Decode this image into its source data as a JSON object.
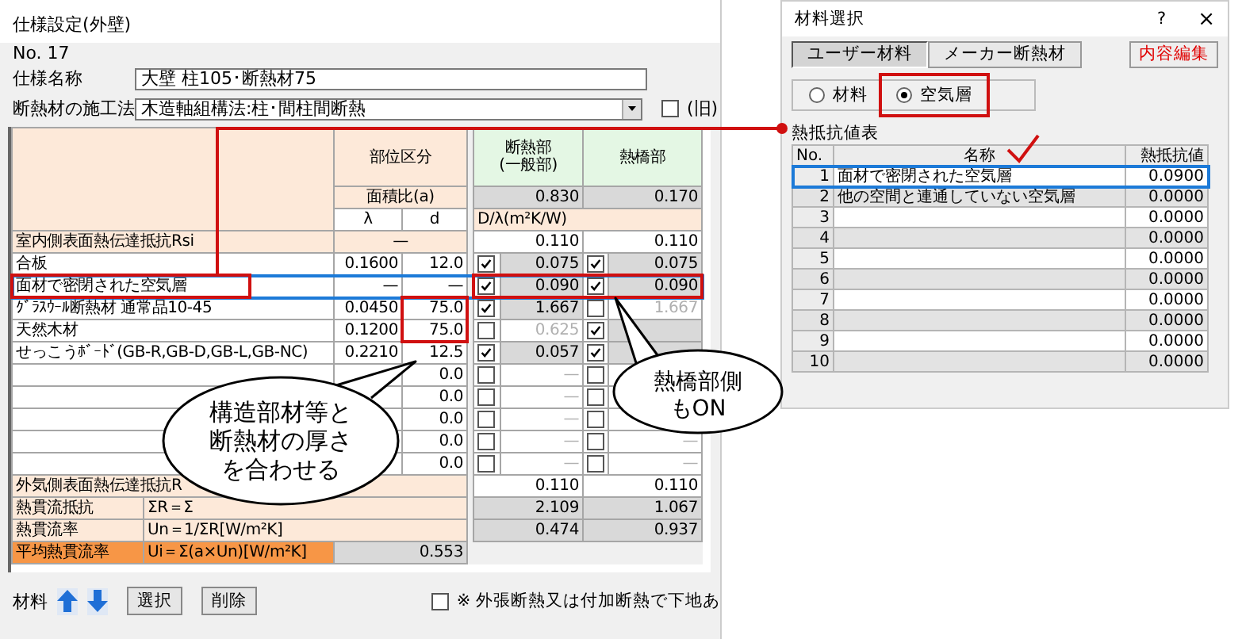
{
  "main_window": {
    "title": "仕様設定(外壁)",
    "number": "No. 17",
    "spec_name": {
      "label": "仕様名称",
      "value": "大壁  柱105･断熱材75"
    },
    "method": {
      "label": "断熱材の施工法",
      "value": "木造軸組構法:柱･間柱間断熱"
    },
    "old_option": {
      "label": "(旧)",
      "checked": false
    },
    "header": {
      "category": "部位区分",
      "insulated": "断熱部\n(一般部)",
      "bridge": "熱橋部",
      "area_ratio_label": "面積比(a)",
      "area_ratio_insulated": "0.830",
      "area_ratio_bridge": "0.170",
      "lambda": "λ",
      "d": "d",
      "resistance_unit": "D/λ(m²K/W)"
    },
    "surface_inner": {
      "name": "室内側表面熱伝達抵抗Rsi",
      "lambda_d": "—",
      "insulated": "0.110",
      "bridge": "0.110"
    },
    "layers": [
      {
        "name": "合板",
        "lambda": "0.1600",
        "d": "12.0",
        "insulated_on": true,
        "insulated": "0.075",
        "bridge_on": true,
        "bridge": "0.075",
        "selected": false
      },
      {
        "name": "面材で密閉された空気層",
        "lambda": "—",
        "d": "—",
        "insulated_on": true,
        "insulated": "0.090",
        "bridge_on": true,
        "bridge": "0.090",
        "selected": true
      },
      {
        "name": "ｸﾞﾗｽｳｰﾙ断熱材 通常品10-45",
        "lambda": "0.0450",
        "d": "75.0",
        "insulated_on": true,
        "insulated": "1.667",
        "bridge_on": false,
        "bridge": "1.667",
        "selected": false
      },
      {
        "name": "天然木材",
        "lambda": "0.1200",
        "d": "75.0",
        "insulated_on": false,
        "insulated": "0.625",
        "bridge_on": true,
        "selected": false
      },
      {
        "name": "せっこうﾎﾞｰﾄﾞ(GB-R,GB-D,GB-L,GB-NC)",
        "lambda": "0.2210",
        "d": "12.5",
        "insulated_on": true,
        "insulated": "0.057",
        "bridge_on": true,
        "selected": false
      },
      {
        "d": "0.0",
        "insulated_on": false,
        "insulated": "—",
        "bridge_on": false,
        "selected": false
      },
      {
        "d": "0.0",
        "insulated_on": false,
        "insulated": "—",
        "bridge_on": false,
        "selected": false
      },
      {
        "d": "0.0",
        "insulated_on": false,
        "insulated": "—",
        "bridge_on": false,
        "selected": false
      },
      {
        "d": "0.0",
        "insulated_on": false,
        "insulated": "—",
        "bridge_on": false,
        "bridge": "—",
        "selected": false
      },
      {
        "d": "0.0",
        "insulated_on": false,
        "insulated": "—",
        "bridge_on": false,
        "bridge": "—",
        "selected": false
      }
    ],
    "totals": [
      {
        "kind": "surface",
        "name": "外気側表面熱伝達抵抗R",
        "insulated": "0.110",
        "bridge": "0.110"
      },
      {
        "kind": "sum",
        "name": "熱貫流抵抗",
        "formula": "ΣR＝Σ",
        "insulated": "2.109",
        "bridge": "1.067"
      },
      {
        "kind": "sum",
        "name": "熱貫流率",
        "formula": "Un＝1/ΣR[W/m²K]",
        "insulated": "0.474",
        "bridge": "0.937"
      }
    ],
    "average": {
      "name": "平均熱貫流率",
      "formula": "Ui＝Σ(a×Un)[W/m²K]",
      "value": "0.553"
    },
    "toolbar": {
      "label": "材料",
      "buttons": [
        "選択",
        "削除"
      ],
      "note": {
        "label": "※ 外張断熱又は付加断熱で下地あ",
        "checked": false
      }
    }
  },
  "material_window": {
    "title": "材料選択",
    "help": "?",
    "close": "×",
    "tabs": [
      {
        "label": "ユーザー材料",
        "selected": true
      },
      {
        "label": "メーカー断熱材",
        "selected": false
      }
    ],
    "edit_button": "内容編集",
    "types": [
      {
        "label": "材料",
        "selected": false
      },
      {
        "label": "空気層",
        "selected": true
      }
    ],
    "table_title": "熱抵抗値表",
    "columns": [
      "No.",
      "名称",
      "熱抵抗値"
    ],
    "rows": [
      {
        "no": "1",
        "name": "面材で密閉された空気層",
        "value": "0.0900",
        "selected": true
      },
      {
        "no": "2",
        "name": "他の空間と連通していない空気層",
        "value": "0.0000",
        "selected": false
      },
      {
        "no": "3",
        "value": "0.0000",
        "selected": false
      },
      {
        "no": "4",
        "value": "0.0000",
        "selected": false
      },
      {
        "no": "5",
        "value": "0.0000",
        "selected": false
      },
      {
        "no": "6",
        "value": "0.0000",
        "selected": false
      },
      {
        "no": "7",
        "value": "0.0000",
        "selected": false
      },
      {
        "no": "8",
        "value": "0.0000",
        "selected": false
      },
      {
        "no": "9",
        "value": "0.0000",
        "selected": false
      },
      {
        "no": "10",
        "value": "0.0000",
        "selected": false
      }
    ]
  },
  "callouts": [
    {
      "text": "構造部材等と断熱材の厚さを合わせる"
    },
    {
      "text": "熱橋部側もON"
    }
  ]
}
